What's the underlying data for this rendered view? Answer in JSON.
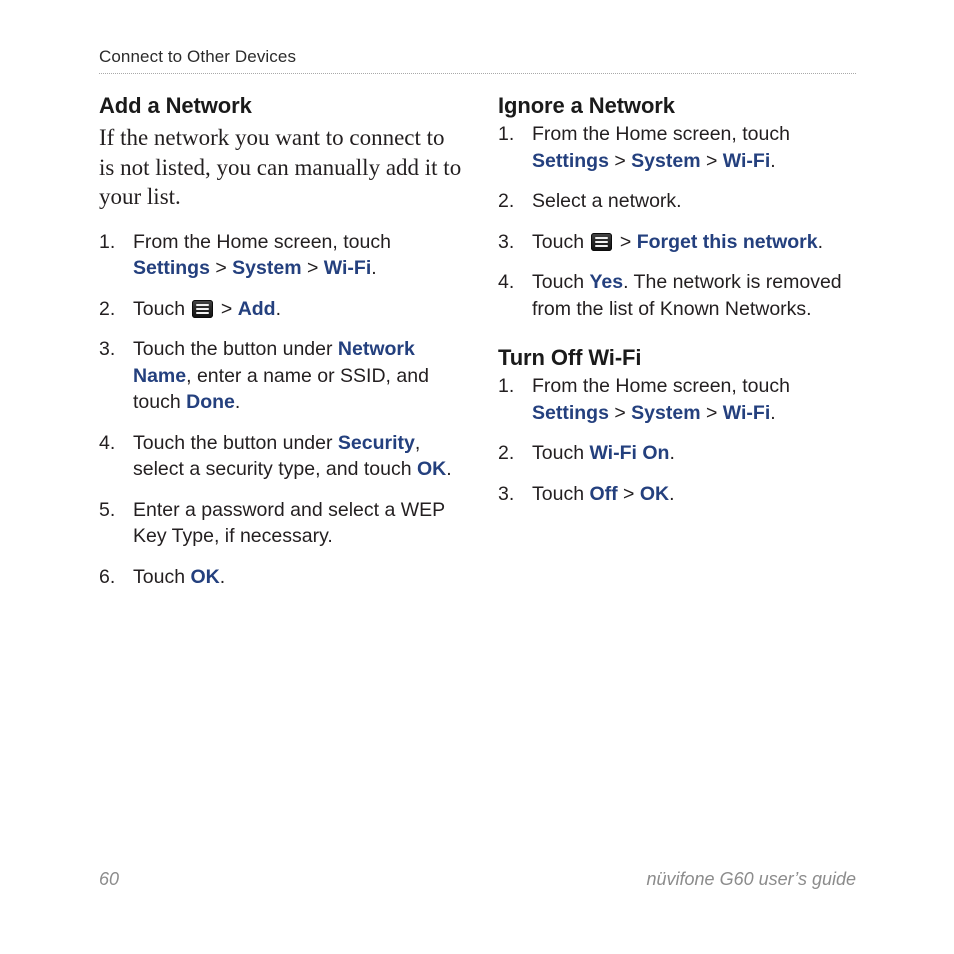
{
  "header": {
    "title": "Connect to Other Devices"
  },
  "left_column": {
    "heading": "Add a Network",
    "intro": "If the network you want to connect to is not listed, you can manually add it to your list.",
    "steps": [
      {
        "number": "1.",
        "parts": [
          {
            "type": "text",
            "text": "From the Home screen, touch "
          },
          {
            "type": "bold",
            "text": "Settings"
          },
          {
            "type": "text",
            "text": " > "
          },
          {
            "type": "bold",
            "text": "System"
          },
          {
            "type": "text",
            "text": " > "
          },
          {
            "type": "bold",
            "text": "Wi-Fi"
          },
          {
            "type": "text",
            "text": "."
          }
        ]
      },
      {
        "number": "2.",
        "parts": [
          {
            "type": "text",
            "text": "Touch "
          },
          {
            "type": "icon",
            "name": "menu-icon"
          },
          {
            "type": "text",
            "text": " > "
          },
          {
            "type": "bold",
            "text": "Add"
          },
          {
            "type": "text",
            "text": "."
          }
        ]
      },
      {
        "number": "3.",
        "parts": [
          {
            "type": "text",
            "text": "Touch the button under "
          },
          {
            "type": "bold",
            "text": "Network Name"
          },
          {
            "type": "text",
            "text": ", enter a name or SSID, and touch "
          },
          {
            "type": "bold",
            "text": "Done"
          },
          {
            "type": "text",
            "text": "."
          }
        ]
      },
      {
        "number": "4.",
        "parts": [
          {
            "type": "text",
            "text": "Touch the button under "
          },
          {
            "type": "bold",
            "text": "Security"
          },
          {
            "type": "text",
            "text": ", select a security type, and touch "
          },
          {
            "type": "bold",
            "text": "OK"
          },
          {
            "type": "text",
            "text": "."
          }
        ]
      },
      {
        "number": "5.",
        "parts": [
          {
            "type": "text",
            "text": "Enter a password and select a WEP Key Type, if necessary."
          }
        ]
      },
      {
        "number": "6.",
        "parts": [
          {
            "type": "text",
            "text": "Touch "
          },
          {
            "type": "bold",
            "text": "OK"
          },
          {
            "type": "text",
            "text": "."
          }
        ]
      }
    ]
  },
  "right_column": {
    "section_one": {
      "heading": "Ignore a Network",
      "steps": [
        {
          "number": "1.",
          "parts": [
            {
              "type": "text",
              "text": "From the Home screen, touch "
            },
            {
              "type": "bold",
              "text": "Settings"
            },
            {
              "type": "text",
              "text": " > "
            },
            {
              "type": "bold",
              "text": "System"
            },
            {
              "type": "text",
              "text": " > "
            },
            {
              "type": "bold",
              "text": "Wi-Fi"
            },
            {
              "type": "text",
              "text": "."
            }
          ]
        },
        {
          "number": "2.",
          "parts": [
            {
              "type": "text",
              "text": "Select a network."
            }
          ]
        },
        {
          "number": "3.",
          "parts": [
            {
              "type": "text",
              "text": "Touch "
            },
            {
              "type": "icon",
              "name": "menu-icon"
            },
            {
              "type": "text",
              "text": " > "
            },
            {
              "type": "bold",
              "text": "Forget this network"
            },
            {
              "type": "text",
              "text": "."
            }
          ]
        },
        {
          "number": "4.",
          "parts": [
            {
              "type": "text",
              "text": "Touch "
            },
            {
              "type": "bold",
              "text": "Yes"
            },
            {
              "type": "text",
              "text": ". The network is removed from the list of Known Networks."
            }
          ]
        }
      ]
    },
    "section_two": {
      "heading": "Turn Off Wi-Fi",
      "steps": [
        {
          "number": "1.",
          "parts": [
            {
              "type": "text",
              "text": "From the Home screen, touch "
            },
            {
              "type": "bold",
              "text": "Settings"
            },
            {
              "type": "text",
              "text": " > "
            },
            {
              "type": "bold",
              "text": "System"
            },
            {
              "type": "text",
              "text": " > "
            },
            {
              "type": "bold",
              "text": "Wi-Fi"
            },
            {
              "type": "text",
              "text": "."
            }
          ]
        },
        {
          "number": "2.",
          "parts": [
            {
              "type": "text",
              "text": "Touch "
            },
            {
              "type": "bold",
              "text": "Wi-Fi On"
            },
            {
              "type": "text",
              "text": "."
            }
          ]
        },
        {
          "number": "3.",
          "parts": [
            {
              "type": "text",
              "text": "Touch "
            },
            {
              "type": "bold",
              "text": "Off"
            },
            {
              "type": "text",
              "text": " > "
            },
            {
              "type": "bold",
              "text": "OK"
            },
            {
              "type": "text",
              "text": "."
            }
          ]
        }
      ]
    }
  },
  "footer": {
    "page_number": "60",
    "guide_title": "nüvifone G60 user’s guide"
  },
  "colors": {
    "accent_blue": "#24407e",
    "body_text": "#231f20",
    "footer_text": "#8c8c8c",
    "rule": "#a9a9a9",
    "page_background": "#ffffff"
  }
}
